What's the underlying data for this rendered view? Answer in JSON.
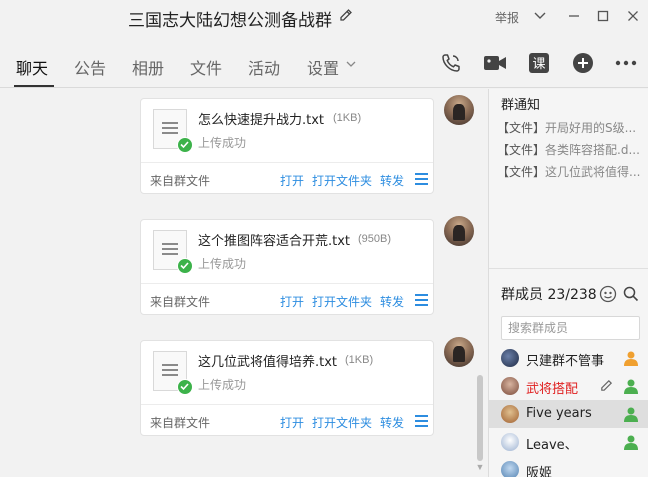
{
  "window": {
    "title": "三国志大陆幻想公测备战群",
    "report_label": "举报"
  },
  "tabs": [
    {
      "label": "聊天",
      "active": true
    },
    {
      "label": "公告"
    },
    {
      "label": "相册"
    },
    {
      "label": "文件"
    },
    {
      "label": "活动"
    },
    {
      "label": "设置"
    }
  ],
  "toolbar_icons": [
    "phone-call-icon",
    "video-call-icon",
    "lesson-icon",
    "add-icon",
    "more-icon"
  ],
  "messages": [
    {
      "file_name": "怎么快速提升战力.txt",
      "size": "(1KB)",
      "status": "上传成功",
      "source": "来自群文件",
      "actions": {
        "open": "打开",
        "open_folder": "打开文件夹",
        "forward": "转发"
      }
    },
    {
      "file_name": "这个推图阵容适合开荒.txt",
      "size": "(950B)",
      "status": "上传成功",
      "source": "来自群文件",
      "actions": {
        "open": "打开",
        "open_folder": "打开文件夹",
        "forward": "转发"
      }
    },
    {
      "file_name": "这几位武将值得培养.txt",
      "size": "(1KB)",
      "status": "上传成功",
      "source": "来自群文件",
      "actions": {
        "open": "打开",
        "open_folder": "打开文件夹",
        "forward": "转发"
      }
    }
  ],
  "notice": {
    "title": "群通知",
    "items": [
      {
        "tag": "【文件】",
        "text": "开局好用的S级..."
      },
      {
        "tag": "【文件】",
        "text": "各类阵容搭配.d..."
      },
      {
        "tag": "【文件】",
        "text": "这几位武将值得..."
      }
    ]
  },
  "members": {
    "title": "群成员 23/238",
    "search_placeholder": "搜索群成员",
    "list": [
      {
        "name": "只建群不管事",
        "color": "#222222",
        "role": "owner"
      },
      {
        "name": "武将搭配",
        "color": "#e02020",
        "role": "member"
      },
      {
        "name": "Five years",
        "color": "#222222",
        "role": "member",
        "selected": true
      },
      {
        "name": "Leave、",
        "color": "#222222",
        "role": "member"
      },
      {
        "name": "阪姬",
        "color": "#222222",
        "role": "none"
      }
    ]
  },
  "colors": {
    "accent": "#2d8de0",
    "success": "#3cb24a",
    "owner": "#f0a030",
    "member": "#4caf50"
  }
}
